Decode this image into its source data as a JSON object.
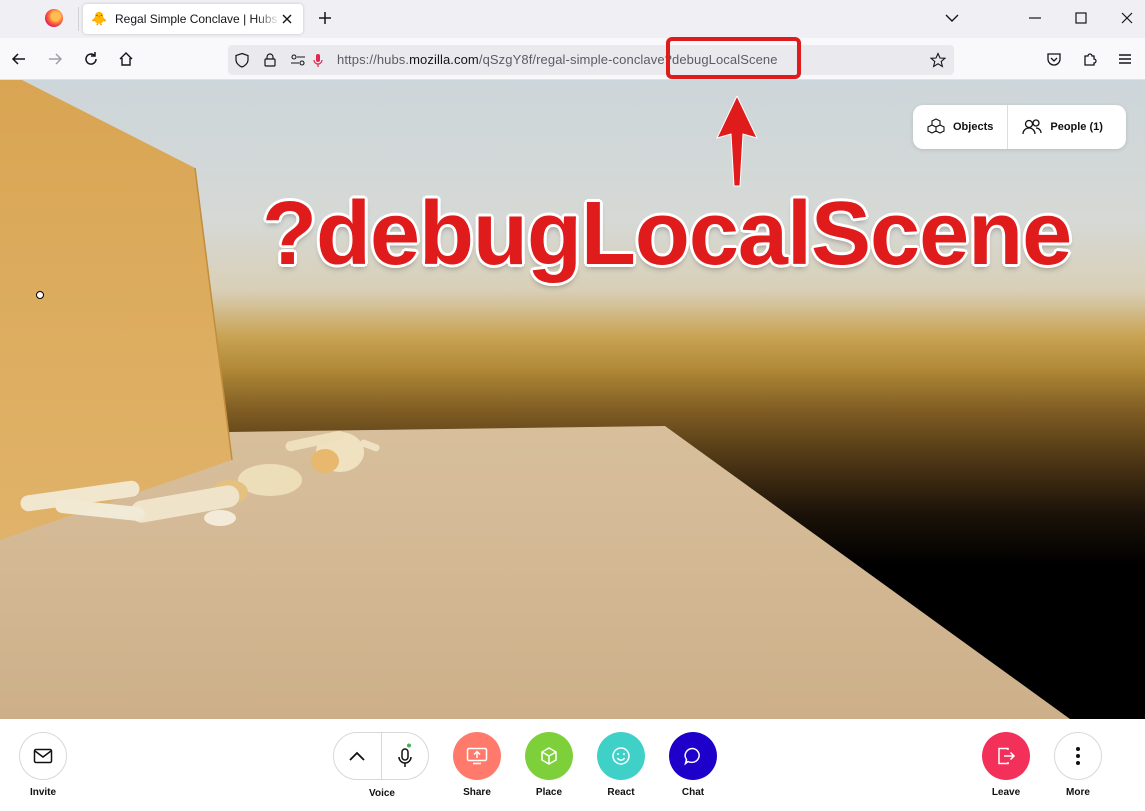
{
  "browser": {
    "tab_title": "Regal Simple Conclave | Hubs by Mozilla",
    "url_prefix": "https://hubs.",
    "url_host": "mozilla.com",
    "url_path": "/qSzgY8f/regal-simple-conclave?debugLocalScene",
    "icons": [
      "firefox-icon",
      "hubs-duck-icon",
      "close-icon",
      "plus-icon",
      "chevron-down-icon",
      "minimize-icon",
      "maximize-icon",
      "window-close-icon",
      "back-arrow-icon",
      "forward-arrow-icon",
      "reload-icon",
      "home-icon",
      "shield-icon",
      "lock-icon",
      "permissions-icon",
      "microphone-icon",
      "star-icon",
      "pocket-icon",
      "extensions-icon",
      "menu-icon"
    ]
  },
  "scene_panel": {
    "objects_label": "Objects",
    "people_label": "People (1)"
  },
  "annotation": {
    "text": "?debugLocalScene",
    "color": "#e01b1b"
  },
  "toolbar": {
    "invite_label": "Invite",
    "voice_label": "Voice",
    "share_label": "Share",
    "place_label": "Place",
    "react_label": "React",
    "chat_label": "Chat",
    "leave_label": "Leave",
    "more_label": "More"
  },
  "colors": {
    "share": "#ff7a6b",
    "place": "#7ed03a",
    "react": "#3fd1c7",
    "chat": "#1d00c9",
    "leave": "#f2305a",
    "floor": "#d4b894",
    "wall": "#d9a553"
  }
}
